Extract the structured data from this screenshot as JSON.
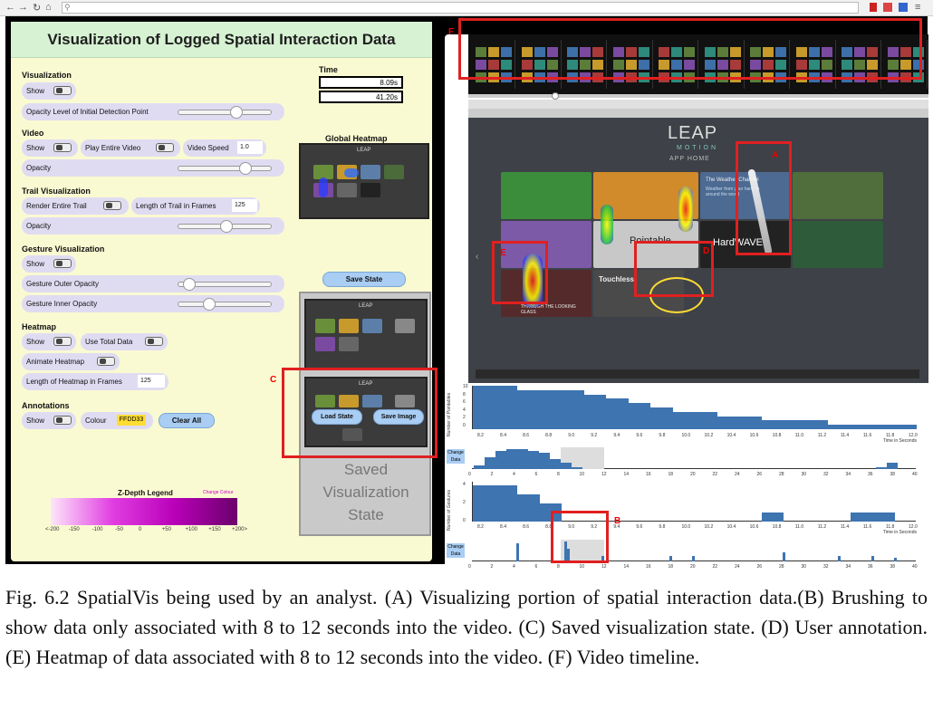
{
  "left": {
    "title": "Visualization of Logged Spatial Interaction Data",
    "visualization": {
      "heading": "Visualization",
      "show": "Show",
      "opacity_initial": "Opacity Level of Initial Detection Point"
    },
    "video": {
      "heading": "Video",
      "show": "Show",
      "play_entire": "Play Entire Video",
      "speed_label": "Video Speed",
      "speed_value": "1.0",
      "opacity": "Opacity"
    },
    "trail": {
      "heading": "Trail Visualization",
      "render_entire": "Render Entire Trail",
      "length_label": "Length of Trail in Frames",
      "length_value": "125",
      "opacity": "Opacity"
    },
    "gesture": {
      "heading": "Gesture Visualization",
      "show": "Show",
      "outer": "Gesture Outer Opacity",
      "inner": "Gesture Inner Opacity"
    },
    "heatmap": {
      "heading": "Heatmap",
      "show": "Show",
      "use_total": "Use Total Data",
      "animate": "Animate Heatmap",
      "length_label": "Length of Heatmap in Frames",
      "length_value": "125"
    },
    "annotations": {
      "heading": "Annotations",
      "show": "Show",
      "colour_label": "Colour",
      "colour_value": "FFDD33",
      "clear_all": "Clear All"
    },
    "time": {
      "heading": "Time",
      "current": "8.09s",
      "total": "41.20s"
    },
    "global_heatmap": "Global Heatmap",
    "save_state": "Save State",
    "load_state": "Load State",
    "save_image": "Save Image",
    "saved_placeholder": [
      "Saved",
      "Visualization",
      "State"
    ],
    "legend": {
      "title": "Z-Depth Legend",
      "change_colour": "Change Colour",
      "ticks": [
        "<-200",
        "-150",
        "-100",
        "-50",
        "0",
        "+50",
        "+100",
        "+150",
        "+200>"
      ]
    },
    "leap_small": "LEAP"
  },
  "right": {
    "app": {
      "logo": "LEAP",
      "sub1": "MOTION",
      "sub2": "APP HOME",
      "tiles": [
        "The Weather Channel",
        "Pointable",
        "HardWAVE",
        "Touchless",
        "THROUGH THE LOOKING GLASS"
      ],
      "weather_sub": "Weather from your hand to around the world"
    },
    "chart1": {
      "ylabel": "Number of Pointables",
      "xlabel": "Time in Seconds",
      "yticks": [
        "10",
        "8",
        "6",
        "4",
        "2",
        "0"
      ],
      "xticks": [
        "8.2",
        "8.4",
        "8.6",
        "8.8",
        "9.0",
        "9.2",
        "9.4",
        "9.6",
        "9.8",
        "10.0",
        "10.2",
        "10.4",
        "10.6",
        "10.8",
        "11.0",
        "11.2",
        "11.4",
        "11.6",
        "11.8",
        "12.0"
      ]
    },
    "chart2": {
      "ylabel": "Number of Gestures",
      "xlabel": "Time in Seconds",
      "yticks": [
        "4",
        "2",
        "0"
      ],
      "xticks": [
        "8.2",
        "8.4",
        "8.6",
        "8.8",
        "9.0",
        "9.2",
        "9.4",
        "9.6",
        "9.8",
        "10.0",
        "10.2",
        "10.4",
        "10.6",
        "10.8",
        "11.0",
        "11.2",
        "11.4",
        "11.6",
        "11.8",
        "12.0"
      ]
    },
    "overview_xticks": [
      "0",
      "2",
      "4",
      "6",
      "8",
      "10",
      "12",
      "14",
      "16",
      "18",
      "20",
      "22",
      "24",
      "26",
      "28",
      "30",
      "32",
      "34",
      "36",
      "38",
      "40"
    ],
    "change_data": "Change Data"
  },
  "labels": {
    "A": "A",
    "B": "B",
    "C": "C",
    "D": "D",
    "E": "E",
    "F": "F"
  },
  "caption": "Fig. 6.2 SpatialVis being used by an analyst. (A) Visualizing portion of spatial interaction data.(B) Brushing to show data only associated with 8 to 12 seconds into the video. (C) Saved visualization state. (D) User annotation. (E) Heatmap of data associated with 8 to 12 seconds into the video. (F) Video timeline."
}
